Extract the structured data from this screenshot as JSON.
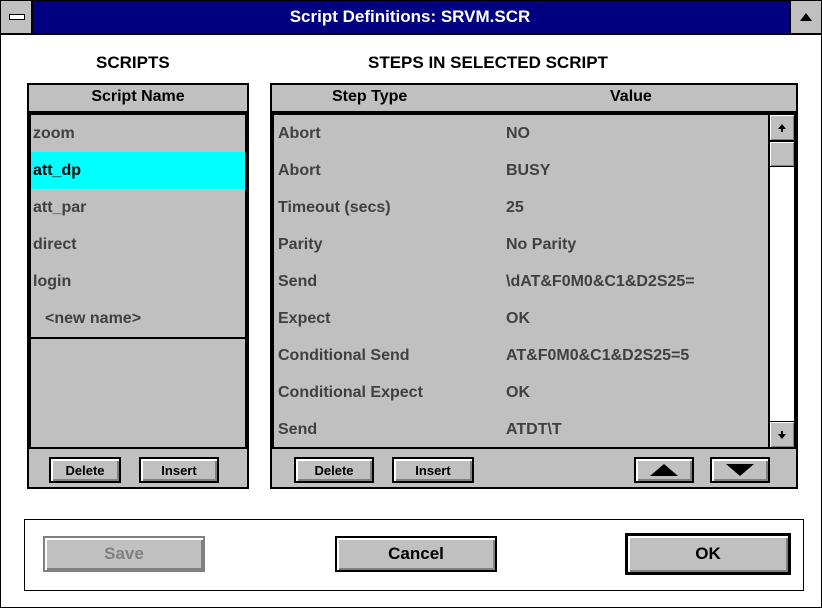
{
  "window": {
    "title": "Script Definitions: SRVM.SCR",
    "system_menu_icon": "system-menu-icon",
    "maximize_icon": "up-arrow-icon"
  },
  "scripts": {
    "section_title": "SCRIPTS",
    "column_header": "Script Name",
    "items": [
      "zoom",
      "att_dp",
      "att_par",
      "direct",
      "login",
      "<new name>"
    ],
    "selected": "att_dp",
    "delete_label": "Delete",
    "insert_label": "Insert"
  },
  "steps": {
    "section_title": "STEPS IN SELECTED SCRIPT",
    "col_type": "Step Type",
    "col_value": "Value",
    "rows": [
      {
        "type": "Abort",
        "value": "NO"
      },
      {
        "type": "Abort",
        "value": "BUSY"
      },
      {
        "type": "Timeout (secs)",
        "value": "25"
      },
      {
        "type": "Parity",
        "value": "No Parity"
      },
      {
        "type": "Send",
        "value": "\\dAT&F0M0&C1&D2S25="
      },
      {
        "type": "Expect",
        "value": "OK"
      },
      {
        "type": "Conditional Send",
        "value": "AT&F0M0&C1&D2S25=5"
      },
      {
        "type": "Conditional Expect",
        "value": "OK"
      },
      {
        "type": "Send",
        "value": "ATDT\\T"
      }
    ],
    "delete_label": "Delete",
    "insert_label": "Insert",
    "move_up_icon": "triangle-up-icon",
    "move_down_icon": "triangle-down-icon"
  },
  "footer": {
    "save_label": "Save",
    "cancel_label": "Cancel",
    "ok_label": "OK"
  },
  "colors": {
    "titlebar": "#000080",
    "selection": "#00ffff",
    "panel": "#c0c0c0"
  }
}
